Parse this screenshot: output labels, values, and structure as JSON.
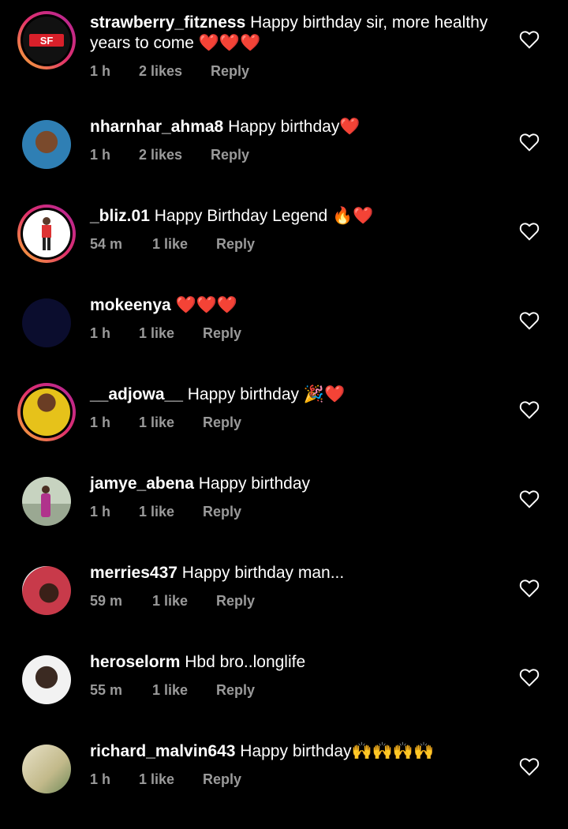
{
  "comments": [
    {
      "username": "strawberry_fitzness",
      "text": "Happy birthday sir, more healthy years to come",
      "emoji": "❤️❤️❤️",
      "time": "1 h",
      "likes": "2 likes",
      "reply": "Reply",
      "avatar_color": "#d8202a",
      "story": true,
      "avatar_logo": "SF"
    },
    {
      "username": "nharnhar_ahma8",
      "text": "Happy birthday",
      "emoji": "❤️",
      "time": "1 h",
      "likes": "2 likes",
      "reply": "Reply",
      "avatar_color": "#2f7fb4",
      "story": false
    },
    {
      "username": "_bliz.01",
      "text": "Happy Birthday Legend",
      "emoji": "🔥❤️",
      "time": "54 m",
      "likes": "1 like",
      "reply": "Reply",
      "avatar_color": "#ffffff",
      "story": true
    },
    {
      "username": "mokeenya",
      "text": "",
      "emoji": "❤️❤️❤️",
      "time": "1 h",
      "likes": "1 like",
      "reply": "Reply",
      "avatar_color": "#0b0d2e",
      "story": false
    },
    {
      "username": "__adjowa__",
      "text": "Happy birthday",
      "emoji": "🎉❤️",
      "time": "1 h",
      "likes": "1 like",
      "reply": "Reply",
      "avatar_color": "#e6c21a",
      "story": true
    },
    {
      "username": "jamye_abena",
      "text": "Happy birthday",
      "emoji": "",
      "time": "1 h",
      "likes": "1 like",
      "reply": "Reply",
      "avatar_color": "#9aa892",
      "story": false
    },
    {
      "username": "merries437",
      "text": "Happy birthday man...",
      "emoji": "",
      "time": "59 m",
      "likes": "1 like",
      "reply": "Reply",
      "avatar_color": "#c83a4a",
      "story": false
    },
    {
      "username": "heroselorm",
      "text": "Hbd bro..longlife",
      "emoji": "",
      "time": "55 m",
      "likes": "1 like",
      "reply": "Reply",
      "avatar_color": "#8c8c8c",
      "story": false
    },
    {
      "username": "richard_malvin643",
      "text": "Happy birthday",
      "emoji": "🙌🙌🙌🙌",
      "time": "1 h",
      "likes": "1 like",
      "reply": "Reply",
      "avatar_color": "#c2b98a",
      "story": false
    }
  ],
  "icons": {
    "like": "heart-outline-icon"
  }
}
